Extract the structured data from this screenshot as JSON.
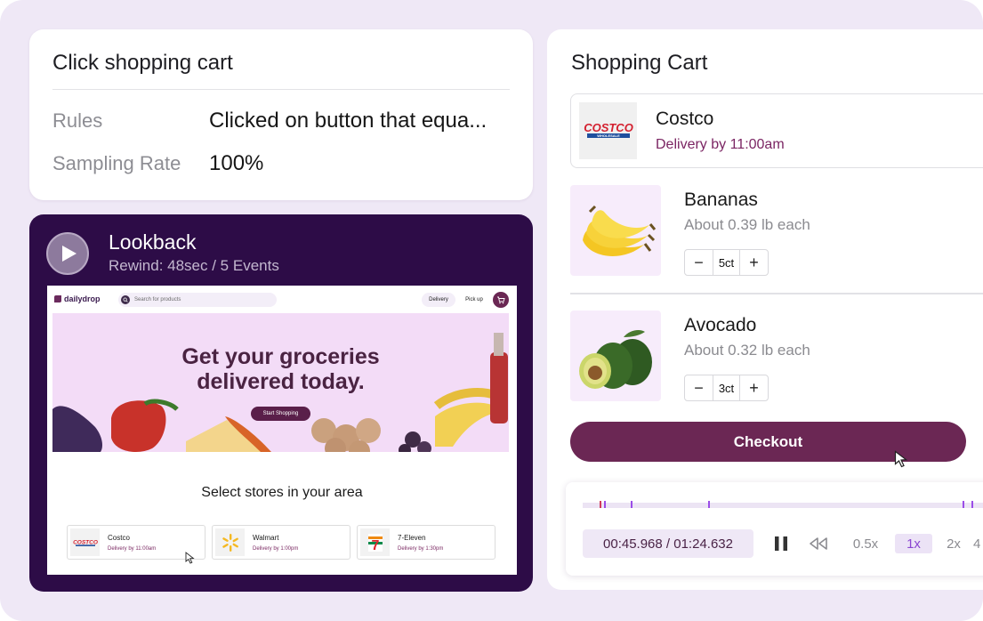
{
  "rules_card": {
    "title": "Click shopping cart",
    "rules_label": "Rules",
    "rules_value": "Clicked on button that equa...",
    "sampling_label": "Sampling Rate",
    "sampling_value": "100%"
  },
  "lookback": {
    "title": "Lookback",
    "subtitle": "Rewind: 48sec / 5 Events",
    "preview": {
      "logo": "dailydrop",
      "search_placeholder": "Search for products",
      "tab_delivery": "Delivery",
      "tab_pickup": "Pick up",
      "hero_line1": "Get your groceries",
      "hero_line2": "delivered today.",
      "hero_button": "Start Shopping",
      "stores_heading": "Select stores in your area",
      "stores": [
        {
          "name": "Costco",
          "delivery": "Delivery by 11:00am"
        },
        {
          "name": "Walmart",
          "delivery": "Delivery by 1:00pm"
        },
        {
          "name": "7-Eleven",
          "delivery": "Delivery by 1:30pm"
        }
      ]
    }
  },
  "cart": {
    "title": "Shopping Cart",
    "store": {
      "name": "Costco",
      "delivery": "Delivery by 11:00am",
      "logo_text": "COSTCO",
      "logo_sub": "WHOLESALE"
    },
    "items": [
      {
        "name": "Bananas",
        "desc": "About 0.39 lb each",
        "qty": "5ct"
      },
      {
        "name": "Avocado",
        "desc": "About 0.32 lb each",
        "qty": "3ct"
      }
    ],
    "minus": "−",
    "plus": "+",
    "checkout_label": "Checkout"
  },
  "player": {
    "time": "00:45.968 / 01:24.632",
    "speeds": [
      "0.5x",
      "1x",
      "2x",
      "4"
    ],
    "active_speed": "1x"
  },
  "colors": {
    "background": "#efe8f6",
    "lookback_bg": "#2d0c47",
    "brand_plum": "#6b2754",
    "delivery_text": "#7b2563",
    "accent_purple": "#8a45d1"
  },
  "icons": [
    "play-icon",
    "search-icon",
    "cart-icon",
    "pause-icon",
    "rewind-icon",
    "cursor-icon",
    "minus-icon",
    "plus-icon"
  ]
}
